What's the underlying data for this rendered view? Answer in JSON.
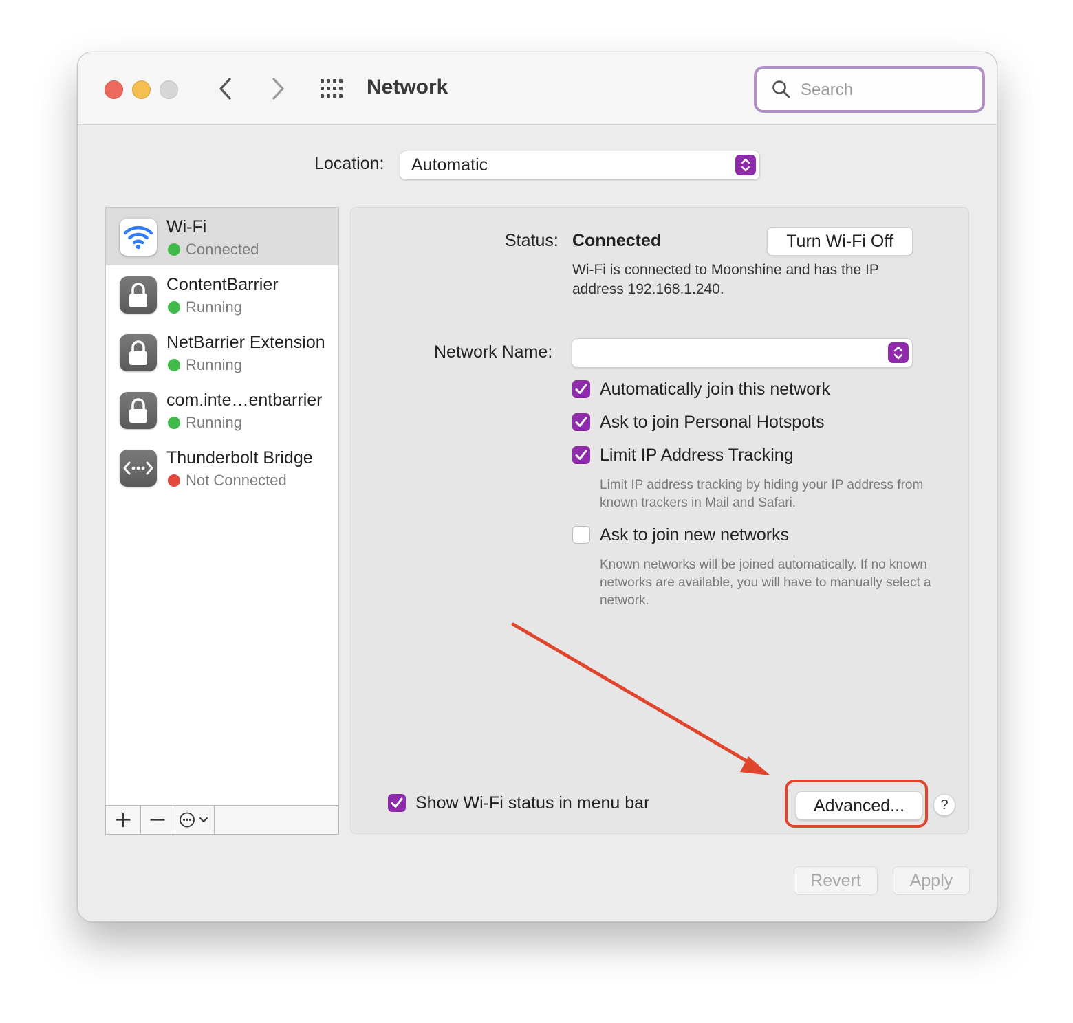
{
  "window": {
    "title": "Network",
    "search_placeholder": "Search"
  },
  "location": {
    "label": "Location:",
    "value": "Automatic"
  },
  "sidebar": {
    "items": [
      {
        "name": "Wi-Fi",
        "status": "Connected",
        "status_color": "#3fba4b",
        "icon": "wifi-icon",
        "selected": true
      },
      {
        "name": "ContentBarrier",
        "status": "Running",
        "status_color": "#3fba4b",
        "icon": "lock-icon"
      },
      {
        "name": "NetBarrier Extension",
        "status": "Running",
        "status_color": "#3fba4b",
        "icon": "lock-icon"
      },
      {
        "name": "com.inte…entbarrier",
        "status": "Running",
        "status_color": "#3fba4b",
        "icon": "lock-icon"
      },
      {
        "name": "Thunderbolt Bridge",
        "status": "Not Connected",
        "status_color": "#e24a3f",
        "icon": "bridge-icon"
      }
    ],
    "toolbar": {
      "add": "+",
      "remove": "—",
      "action_icon": "ellipsis-circle-icon"
    }
  },
  "detail": {
    "status_label": "Status:",
    "status_value": "Connected",
    "toggle_button": "Turn Wi-Fi Off",
    "status_description": "Wi-Fi is connected to Moonshine and has the IP address 192.168.1.240.",
    "network_name_label": "Network Name:",
    "network_name_value": "",
    "options": [
      {
        "label": "Automatically join this network",
        "checked": true
      },
      {
        "label": "Ask to join Personal Hotspots",
        "checked": true
      },
      {
        "label": "Limit IP Address Tracking",
        "checked": true
      },
      {
        "label": "Ask to join new networks",
        "checked": false
      }
    ],
    "limit_ip_description": "Limit IP address tracking by hiding your IP address from known trackers in Mail and Safari.",
    "new_networks_description": "Known networks will be joined automatically. If no known networks are available, you will have to manually select a network.",
    "show_status_label": "Show Wi-Fi status in menu bar",
    "show_status_checked": true,
    "advanced_button": "Advanced...",
    "help_button": "?"
  },
  "footer": {
    "revert": "Revert",
    "apply": "Apply"
  },
  "colors": {
    "accent": "#8e2bab",
    "annotation": "#e0452e",
    "search_focus": "#b08fc4"
  }
}
